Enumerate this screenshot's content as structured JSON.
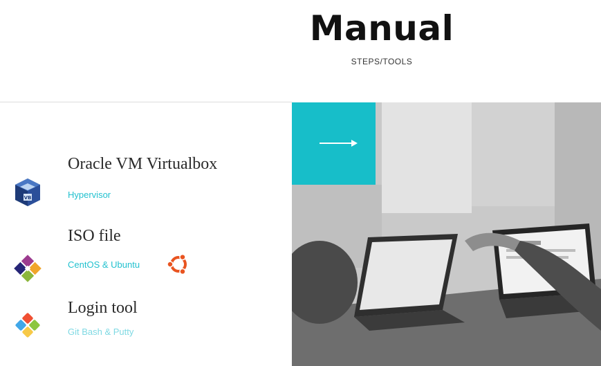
{
  "header": {
    "title": "Manual",
    "subtitle": "STEPS/TOOLS"
  },
  "items": [
    {
      "title": "Oracle VM Virtualbox",
      "subtitle": "Hypervisor",
      "icon": "virtualbox-icon"
    },
    {
      "title": "ISO file",
      "subtitle": "CentOS & Ubuntu",
      "icon": "centos-icon",
      "extra_icon": "ubuntu-icon"
    },
    {
      "title": "Login tool",
      "subtitle": "Git Bash & Putty",
      "icon": "git-icon"
    }
  ],
  "hero": {
    "arrow_icon": "arrow-right-icon",
    "image": "people-with-laptops-photo"
  },
  "colors": {
    "accent": "#17bec9",
    "link": "#22c1cf"
  }
}
